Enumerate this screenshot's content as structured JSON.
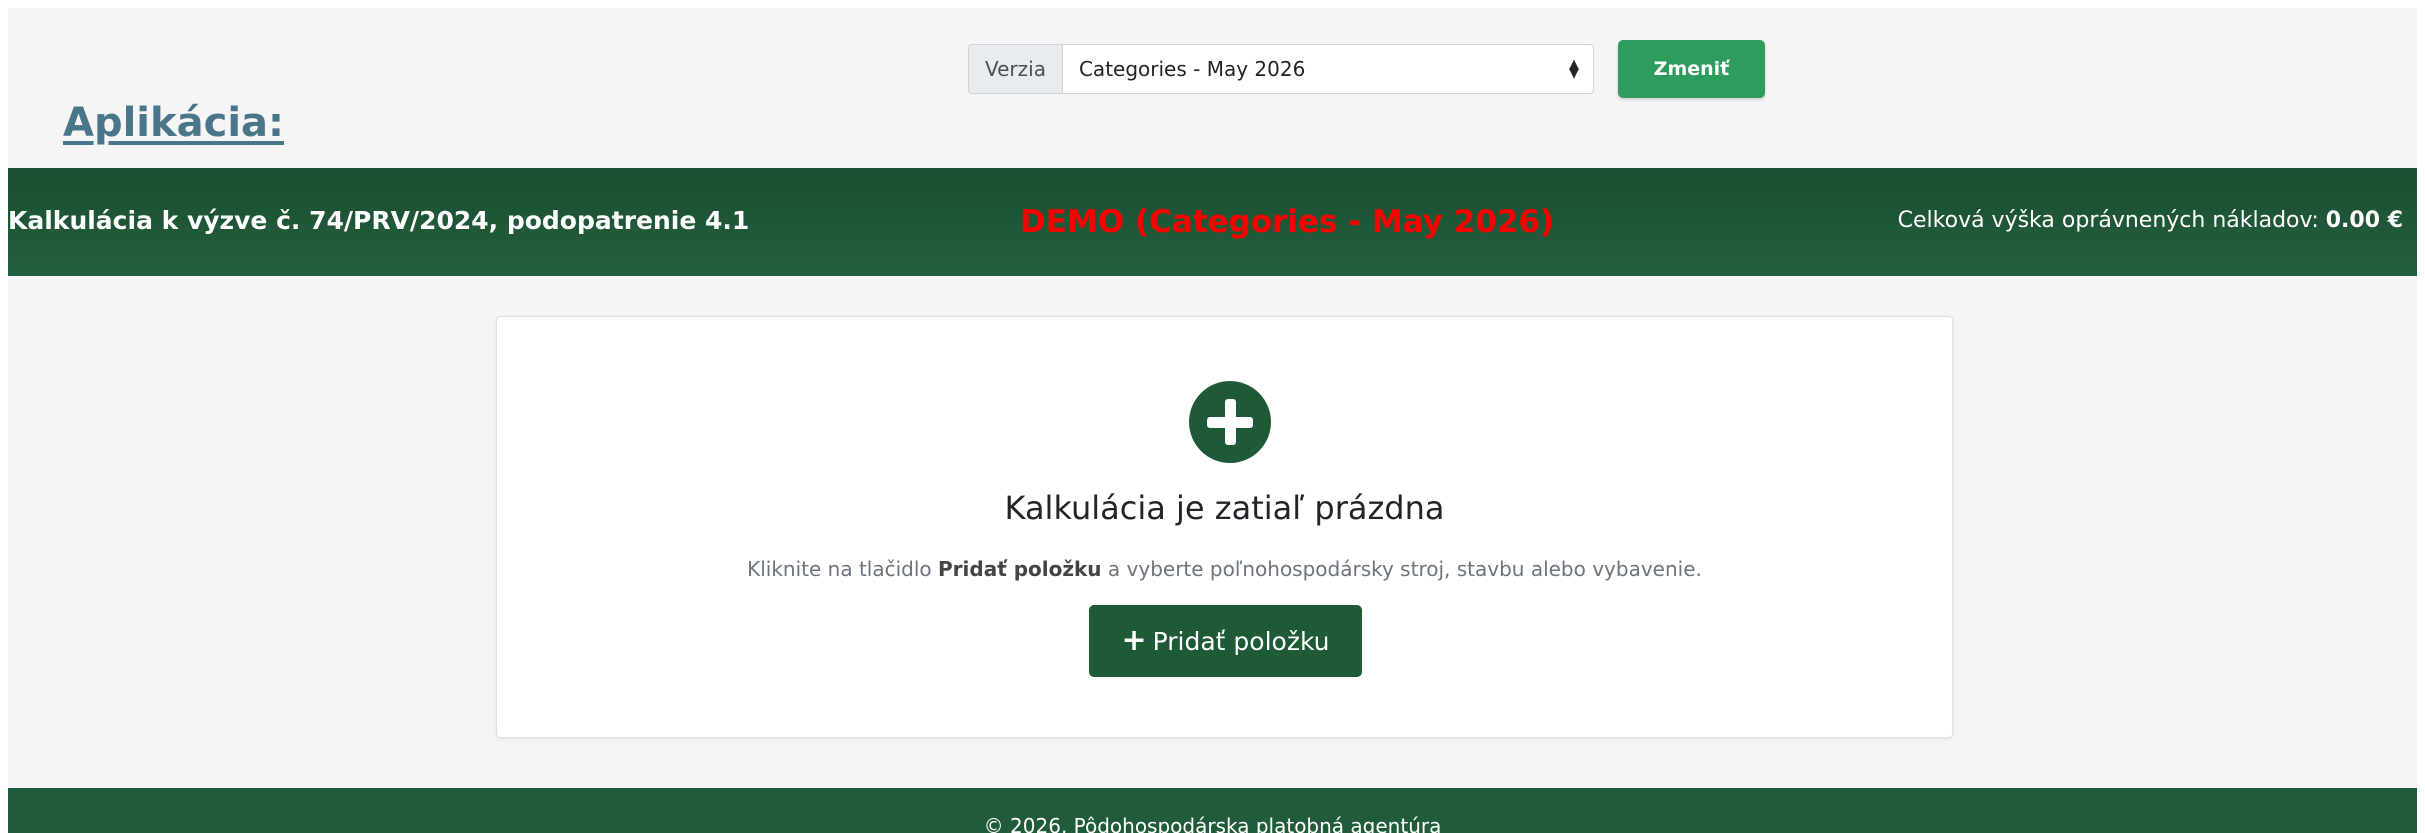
{
  "version_bar": {
    "label": "Verzia",
    "selected": "Categories - May 2026",
    "change_button": "Zmeniť"
  },
  "app_title": "Aplikácia:",
  "header": {
    "title": "Kalkulácia k výzve č. 74/PRV/2024, podopatrenie 4.1",
    "demo": "DEMO (Categories - May 2026)",
    "total_label": "Celková výška oprávnených nákladov:",
    "total_value": "0.00 €"
  },
  "empty_state": {
    "heading": "Kalkulácia je zatiaľ prázdna",
    "hint_before": "Kliknite na tlačidlo",
    "hint_bold": "Pridať položku",
    "hint_after": "a vyberte poľnohospodársky stroj, stavbu alebo vybavenie.",
    "add_button": "Pridať položku"
  },
  "footer": {
    "text": "© 2026, Pôdohospodárska platobná agentúra"
  },
  "colors": {
    "primary_green": "#1f5a37",
    "change_button_green": "#2e9c5c",
    "demo_red": "#ff0000",
    "title_blue": "#4a7689"
  },
  "icons": {
    "empty_state_icon": "plus-circle-icon",
    "select_icon": "select-arrows-icon"
  }
}
